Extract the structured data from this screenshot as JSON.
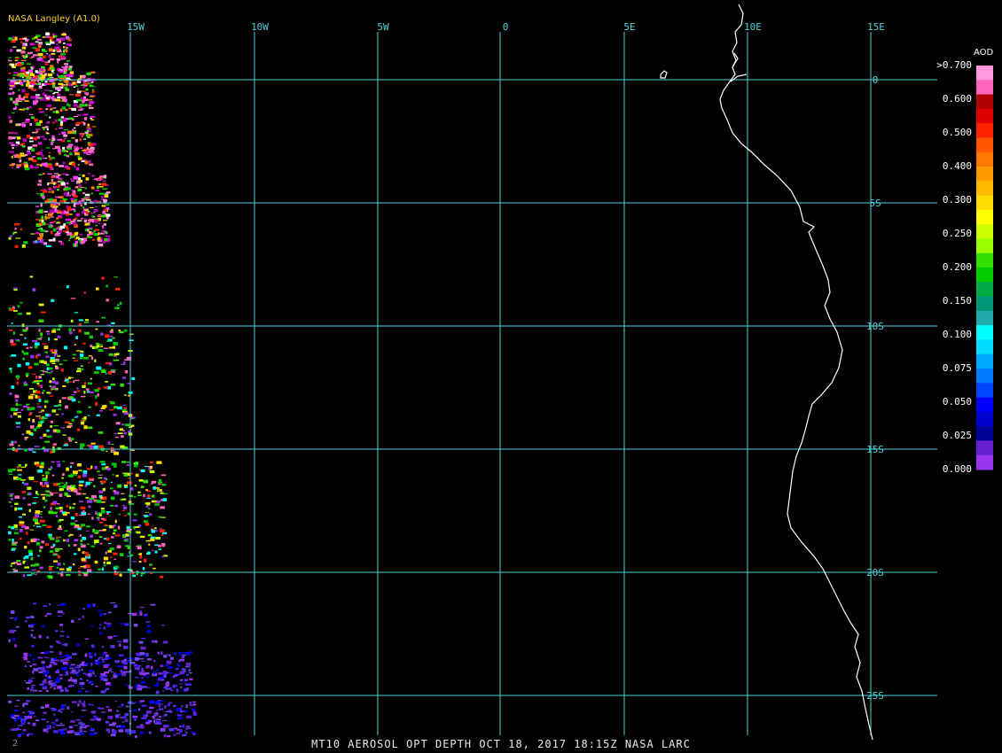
{
  "provider_label": "NASA Langley (A1.0)",
  "footer": {
    "text": "MT10  AEROSOL OPT DEPTH   OCT 18, 2017 18:15Z   NASA LARC",
    "mark": "2"
  },
  "grid": {
    "longitude_labels": [
      "15W",
      "10W",
      "5W",
      "0",
      "5E",
      "10E",
      "15E"
    ],
    "latitude_labels": [
      "0",
      "5S",
      "10S",
      "15S",
      "20S",
      "25S"
    ],
    "line_color": "#4fd3dc"
  },
  "legend": {
    "title": "AOD",
    "tick_labels": [
      ">0.700",
      "0.600",
      "0.500",
      "0.400",
      "0.300",
      "0.250",
      "0.200",
      "0.150",
      "0.100",
      "0.075",
      "0.050",
      "0.025",
      "0.000"
    ],
    "colors": [
      "#ff99dd",
      "#ff66bb",
      "#b00000",
      "#dd0000",
      "#ff2200",
      "#ff5500",
      "#ff7700",
      "#ff9900",
      "#ffbb00",
      "#ffdd00",
      "#ffff00",
      "#ccff00",
      "#99ff00",
      "#33dd00",
      "#00cc00",
      "#00aa44",
      "#009977",
      "#22aaaa",
      "#00ffff",
      "#00ddff",
      "#00aaff",
      "#0077ff",
      "#0044ff",
      "#0000ff",
      "#0000cc",
      "#000099",
      "#6622cc",
      "#9933ee"
    ]
  }
}
